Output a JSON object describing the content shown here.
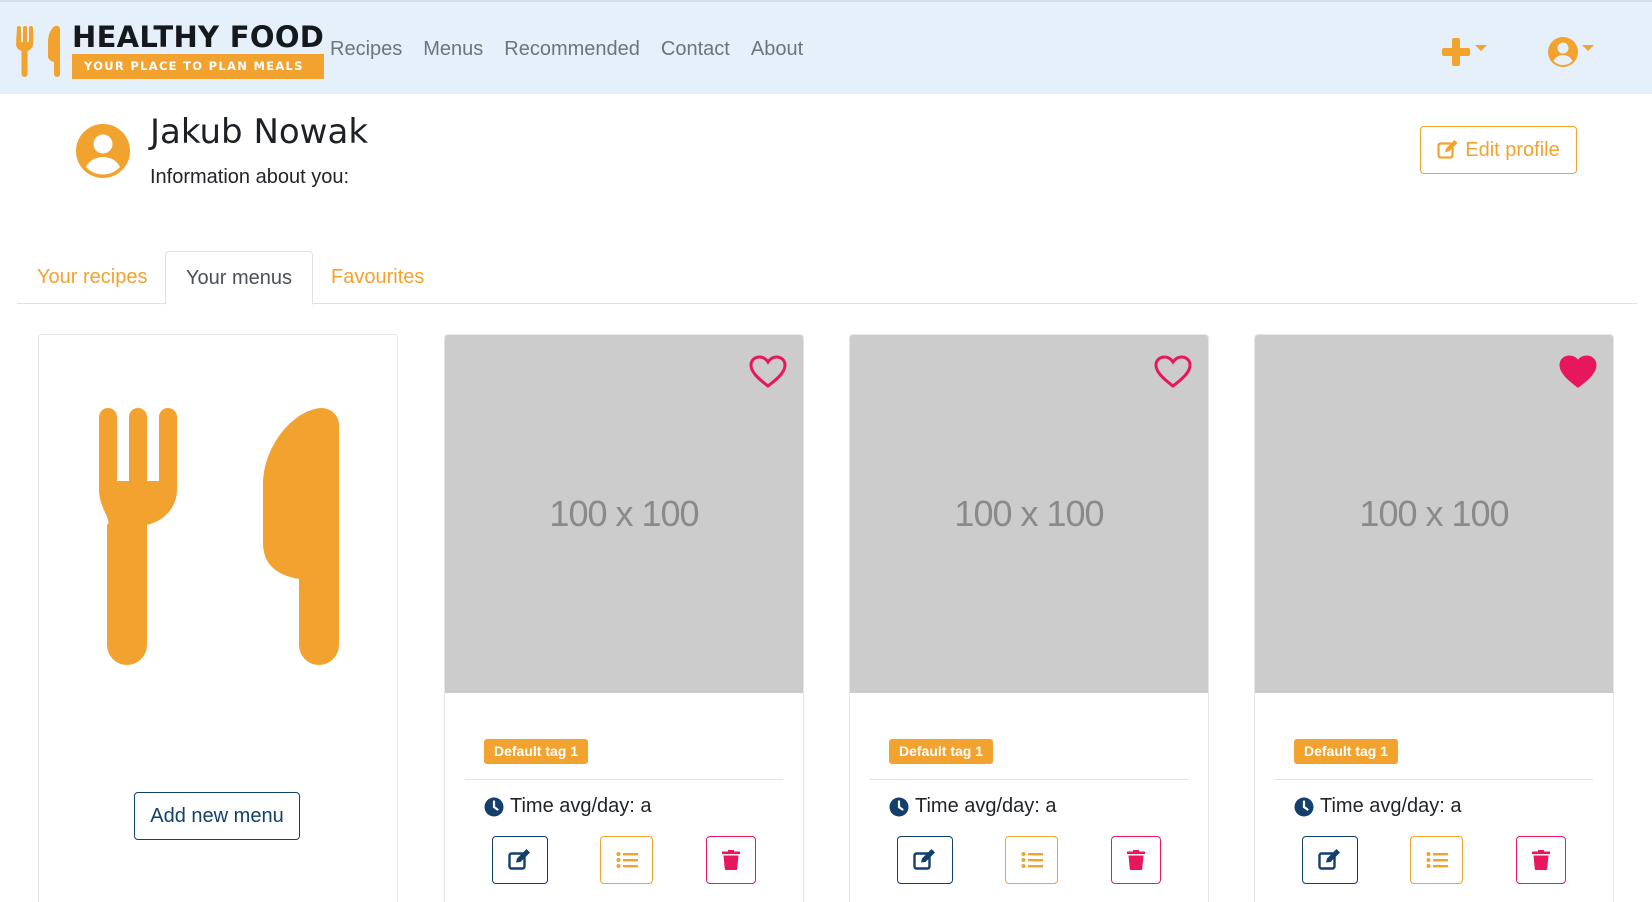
{
  "brand": {
    "title": "HEALTHY FOOD",
    "subtitle": "YOUR PLACE TO PLAN MEALS",
    "logo_icon": "fork-knife-icon"
  },
  "nav": {
    "links": [
      "Recipes",
      "Menus",
      "Recommended",
      "Contact",
      "About"
    ],
    "add_icon": "plus-icon",
    "user_icon": "user-circle-icon"
  },
  "profile": {
    "name": "Jakub Nowak",
    "info_label": "Information about you:",
    "edit_label": "Edit profile"
  },
  "tabs": [
    {
      "label": "Your recipes",
      "active": false
    },
    {
      "label": "Your menus",
      "active": true
    },
    {
      "label": "Favourites",
      "active": false
    }
  ],
  "add_card": {
    "button_label": "Add new menu",
    "icon": "fork-knife-icon"
  },
  "menu_cards": [
    {
      "image_text": "100 x 100",
      "favourite": false,
      "tag": "Default tag 1",
      "time_label": "Time avg/day: a"
    },
    {
      "image_text": "100 x 100",
      "favourite": false,
      "tag": "Default tag 1",
      "time_label": "Time avg/day: a"
    },
    {
      "image_text": "100 x 100",
      "favourite": true,
      "tag": "Default tag 1",
      "time_label": "Time avg/day: a"
    }
  ],
  "colors": {
    "accent": "#f2a22e",
    "navy": "#123f6b",
    "danger": "#e8175d",
    "navbar_bg": "#e6f0fb",
    "placeholder_bg": "#cccccc"
  }
}
